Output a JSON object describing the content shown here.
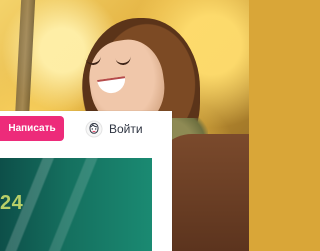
{
  "header": {
    "write_button_label": "Написать",
    "login_label": "Войти",
    "login_icon": "user-avatar-icon"
  },
  "banner": {
    "year_fragment": "24"
  },
  "colors": {
    "accent": "#ed2b7a",
    "banner_dark": "#0d4f49",
    "banner_light": "#1a8a72",
    "banner_text": "#b8cf68"
  },
  "images": {
    "background_photo": "hero-photo-woman-autumn"
  }
}
